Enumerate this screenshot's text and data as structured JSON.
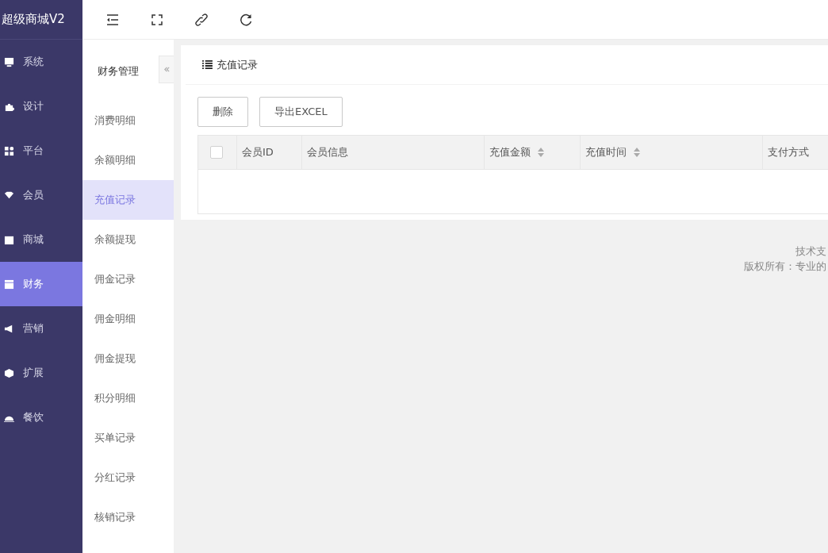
{
  "app": {
    "title": "超级商城V2"
  },
  "nav": [
    {
      "label": "系统",
      "selected": false
    },
    {
      "label": "设计",
      "selected": false
    },
    {
      "label": "平台",
      "selected": false
    },
    {
      "label": "会员",
      "selected": false
    },
    {
      "label": "商城",
      "selected": false
    },
    {
      "label": "财务",
      "selected": true
    },
    {
      "label": "营销",
      "selected": false
    },
    {
      "label": "扩展",
      "selected": false
    },
    {
      "label": "餐饮",
      "selected": false
    }
  ],
  "submenu": {
    "title": "财务管理",
    "items": [
      {
        "label": "消费明细",
        "selected": false
      },
      {
        "label": "余额明细",
        "selected": false
      },
      {
        "label": "充值记录",
        "selected": true
      },
      {
        "label": "余额提现",
        "selected": false
      },
      {
        "label": "佣金记录",
        "selected": false
      },
      {
        "label": "佣金明细",
        "selected": false
      },
      {
        "label": "佣金提现",
        "selected": false
      },
      {
        "label": "积分明细",
        "selected": false
      },
      {
        "label": "买单记录",
        "selected": false
      },
      {
        "label": "分红记录",
        "selected": false
      },
      {
        "label": "核销记录",
        "selected": false
      }
    ]
  },
  "panel": {
    "title": "充值记录",
    "buttons": [
      "删除",
      "导出EXCEL"
    ],
    "table": {
      "select_all": {
        "checked": false
      },
      "columns": [
        {
          "label": "会员ID",
          "sortable": false
        },
        {
          "label": "会员信息",
          "sortable": false
        },
        {
          "label": "充值金额",
          "sortable": true
        },
        {
          "label": "充值时间",
          "sortable": true
        },
        {
          "label": "支付方式",
          "sortable": false
        }
      ]
    }
  },
  "footer": [
    "技术支",
    "版权所有：专业的"
  ]
}
